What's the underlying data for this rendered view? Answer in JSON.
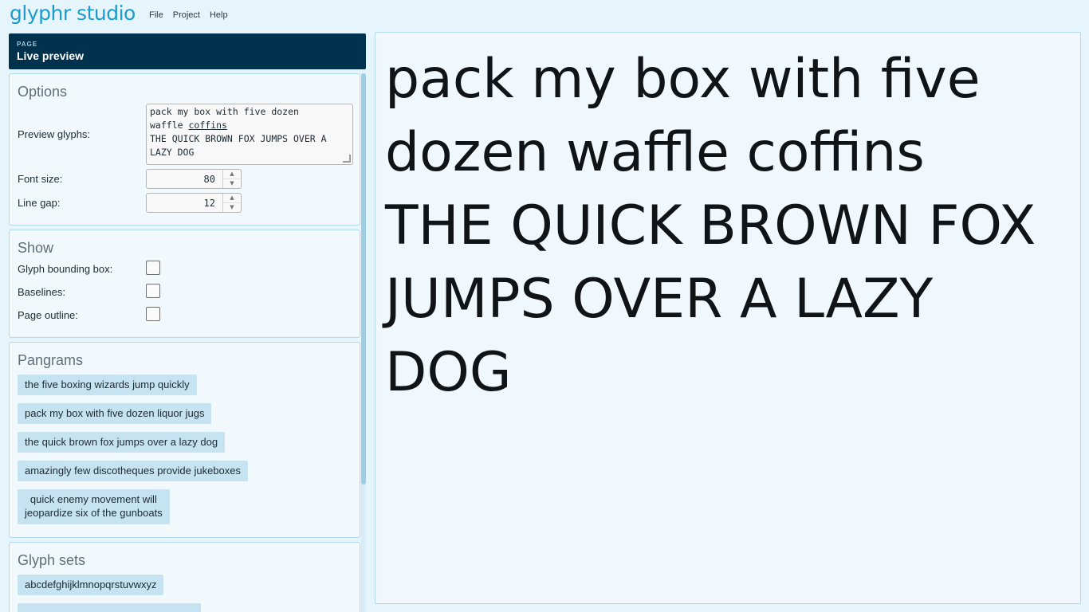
{
  "app": {
    "logo": "glyphr studio",
    "menu": [
      "File",
      "Project",
      "Help"
    ]
  },
  "page": {
    "eyebrow": "PAGE",
    "title": "Live preview"
  },
  "options": {
    "title": "Options",
    "preview_glyphs_label": "Preview glyphs:",
    "preview_glyphs_value_line1a": "pack my box with five dozen\nwaffle ",
    "preview_glyphs_value_line1b": "coffins",
    "preview_glyphs_value_line2": "\nTHE QUICK BROWN FOX JUMPS OVER A\nLAZY DOG",
    "font_size_label": "Font size:",
    "font_size_value": "80",
    "line_gap_label": "Line gap:",
    "line_gap_value": "12"
  },
  "show": {
    "title": "Show",
    "glyph_bounding_box_label": "Glyph bounding box:",
    "baselines_label": "Baselines:",
    "page_outline_label": "Page outline:"
  },
  "pangrams": {
    "title": "Pangrams",
    "items": [
      "the five boxing wizards jump quickly",
      "pack my box with five dozen liquor jugs",
      "the quick brown fox jumps over a lazy dog",
      "amazingly few discotheques provide jukeboxes",
      "quick enemy movement will\njeopardize six of the gunboats"
    ]
  },
  "glyph_sets": {
    "title": "Glyph sets",
    "items": [
      "abcdefghijklmnopqrstuvwxyz"
    ]
  },
  "preview": {
    "text": "pack my box with five\ndozen waffle coffins\nTHE QUICK BROWN FOX\nJUMPS OVER A LAZY DOG"
  }
}
